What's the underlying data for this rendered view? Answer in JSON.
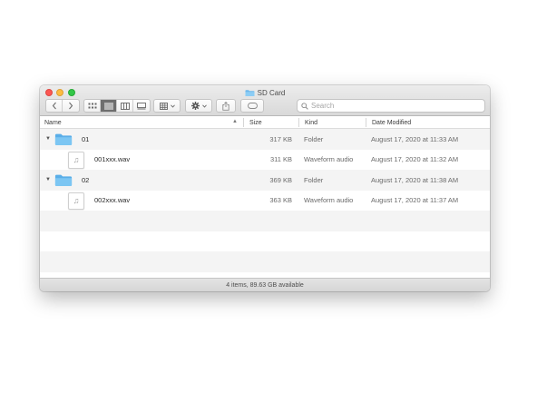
{
  "window": {
    "title": "SD Card",
    "folder_color": "#6cb8ec"
  },
  "toolbar": {
    "back_icon": "chevron-left-icon",
    "forward_icon": "chevron-right-icon",
    "view_modes": [
      "icon-view-icon",
      "list-view-icon",
      "column-view-icon",
      "gallery-view-icon"
    ],
    "active_view": "list-view-icon",
    "group_icon": "group-grid-icon",
    "action_icon": "gear-icon",
    "share_icon": "share-icon",
    "tag_icon": "tag-icon",
    "search_placeholder": "Search"
  },
  "columns": {
    "name": "Name",
    "size": "Size",
    "kind": "Kind",
    "date": "Date Modified"
  },
  "rows": [
    {
      "name": "01",
      "size": "317 KB",
      "kind": "Folder",
      "date": "August 17, 2020 at 11:33 AM",
      "type": "folder"
    },
    {
      "name": "001xxx.wav",
      "size": "311 KB",
      "kind": "Waveform audio",
      "date": "August 17, 2020 at 11:32 AM",
      "type": "file"
    },
    {
      "name": "02",
      "size": "369 KB",
      "kind": "Folder",
      "date": "August 17, 2020 at 11:38 AM",
      "type": "folder"
    },
    {
      "name": "002xxx.wav",
      "size": "363 KB",
      "kind": "Waveform audio",
      "date": "August 17, 2020 at 11:37 AM",
      "type": "file"
    }
  ],
  "status": "4 items, 89.63 GB available",
  "colors": {
    "close": "#fc5753",
    "minimize": "#fdbc40",
    "maximize": "#33c748",
    "row_alt": "#f4f4f4"
  }
}
